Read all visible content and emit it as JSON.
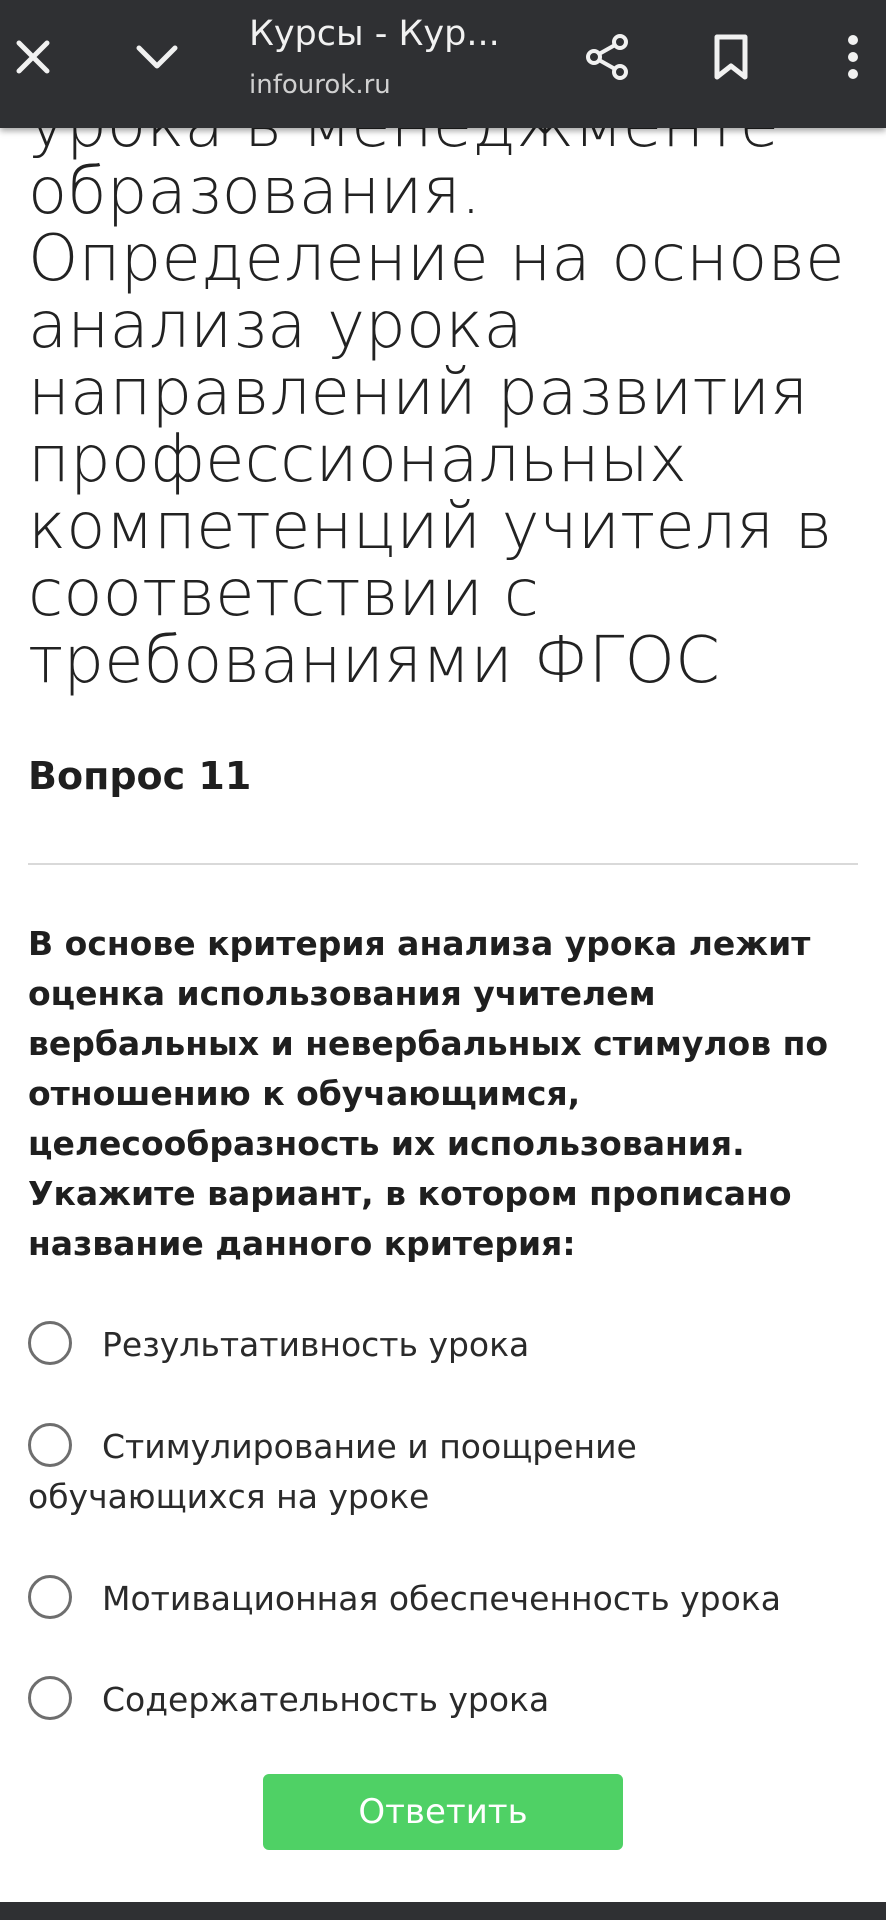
{
  "browser": {
    "title": "Курсы - Кур...",
    "url": "infourok.ru",
    "icons": [
      "close-icon",
      "chevron-down-icon",
      "share-icon",
      "bookmark-icon",
      "more-vert-icon"
    ]
  },
  "lesson": {
    "title": "урока в менеджменте образования. Определение на основе анализа урока направлений развития профессиональных компетенций учителя в соответствии с требованиями ФГОС"
  },
  "question": {
    "label": "Вопрос 11",
    "text": "В основе критерия анализа урока лежит оценка использования учителем вербальных и невербальных стимулов по отношению к обучающимся, целесообразность их использования. Укажите вариант, в котором прописано название данного критерия:",
    "options": [
      {
        "label": "Результативность урока"
      },
      {
        "label": "Стимулирование и поощрение обучающихся на уроке"
      },
      {
        "label": "Мотивационная обеспеченность урока"
      },
      {
        "label": "Содержательность урока"
      }
    ],
    "submit_label": "Ответить"
  },
  "colors": {
    "topbar": "#2f3033",
    "submit": "#4fd165",
    "divider": "#d9d9d9"
  }
}
